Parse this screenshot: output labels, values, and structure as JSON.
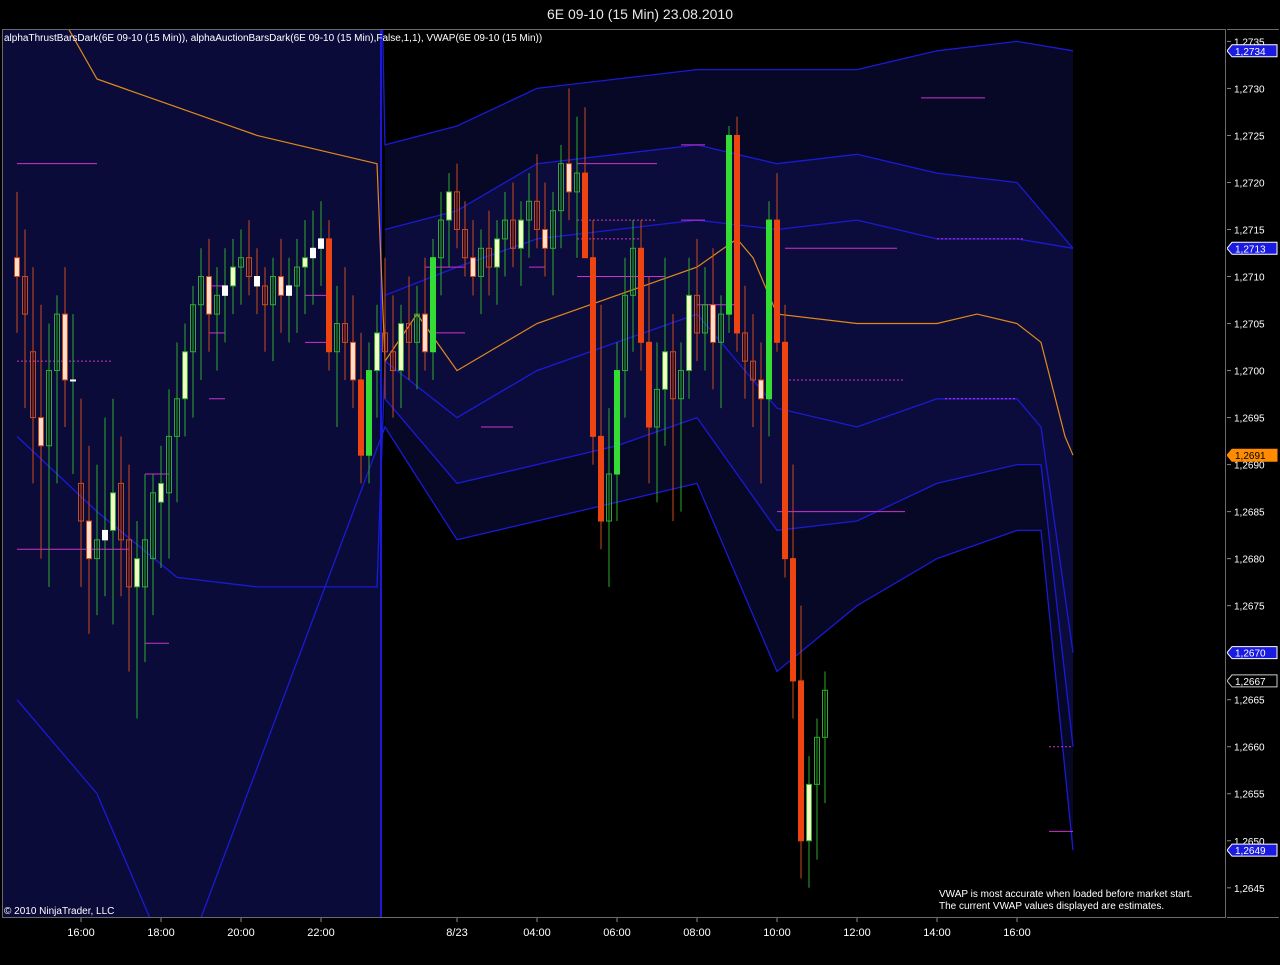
{
  "window": {
    "title": "6E 09-10 (15 Min)  23.08.2010"
  },
  "indicator_label": "alphaThrustBarsDark(6E 09-10 (15 Min)), alphaAuctionBarsDark(6E 09-10 (15 Min),False,1,1), VWAP(6E 09-10 (15 Min))",
  "copyright": "© 2010 NinjaTrader, LLC",
  "notes": {
    "vwap_line1": "VWAP is most accurate when loaded before market start.",
    "vwap_line2": "The current VWAP values displayed are estimates."
  },
  "colors": {
    "background": "#000000",
    "session_shade": "#0b0b3a",
    "band_line": "#1a1ad6",
    "vwap_line": "#e08a1c",
    "up_thrust": "#33dd33",
    "down_thrust": "#ee4411",
    "wick_green": "#2eaa2e",
    "wick_orange": "#cc4a1a",
    "level_marker": "#cc33cc",
    "badge_blue": "#1a1ae0",
    "badge_orange": "#ff8c00"
  },
  "chart_data": {
    "type": "candlestick",
    "symbol": "6E 09-10",
    "interval": "15 Min",
    "date": "23.08.2010",
    "y_axis": {
      "ticks": [
        "1,2735",
        "1,2730",
        "1,2725",
        "1,2720",
        "1,2715",
        "1,2710",
        "1,2705",
        "1,2700",
        "1,2695",
        "1,2690",
        "1,2685",
        "1,2680",
        "1,2675",
        "1,2670",
        "1,2665",
        "1,2660",
        "1,2655",
        "1,2650",
        "1,2645"
      ],
      "range": [
        1.2642,
        1.2736
      ]
    },
    "x_axis": {
      "ticks": [
        "16:00",
        "18:00",
        "20:00",
        "22:00",
        "8/23",
        "04:00",
        "06:00",
        "08:00",
        "10:00",
        "12:00",
        "14:00",
        "16:00"
      ],
      "tick_bar_index": [
        8,
        18,
        28,
        38,
        55,
        65,
        75,
        85,
        95,
        105,
        115,
        125
      ]
    },
    "session_break_bar": 45.5,
    "price_badges": [
      {
        "label": "1,2734",
        "value": 1.2734,
        "style": "blue"
      },
      {
        "label": "1,2713",
        "value": 1.2713,
        "style": "blue"
      },
      {
        "label": "1,2691",
        "value": 1.2691,
        "style": "orange"
      },
      {
        "label": "1,2670",
        "value": 1.267,
        "style": "blue"
      },
      {
        "label": "1,2667",
        "value": 1.2667,
        "style": "black"
      },
      {
        "label": "1,2649",
        "value": 1.2649,
        "style": "blue"
      }
    ],
    "bars_ohlc": [
      [
        1.2712,
        1.2719,
        1.2704,
        1.271
      ],
      [
        1.271,
        1.2715,
        1.2696,
        1.2706
      ],
      [
        1.2702,
        1.2711,
        1.2688,
        1.2695
      ],
      [
        1.2695,
        1.2707,
        1.268,
        1.2692
      ],
      [
        1.2692,
        1.2705,
        1.2677,
        1.27
      ],
      [
        1.27,
        1.2708,
        1.2688,
        1.2706
      ],
      [
        1.2706,
        1.2711,
        1.2694,
        1.2699
      ],
      [
        1.2699,
        1.2706,
        1.2689,
        1.2699
      ],
      [
        1.2688,
        1.2697,
        1.2677,
        1.2684
      ],
      [
        1.2684,
        1.2692,
        1.2672,
        1.268
      ],
      [
        1.268,
        1.269,
        1.2674,
        1.2682
      ],
      [
        1.2682,
        1.2695,
        1.2676,
        1.2683
      ],
      [
        1.2683,
        1.2697,
        1.2673,
        1.2687
      ],
      [
        1.2688,
        1.2693,
        1.2676,
        1.2682
      ],
      [
        1.2682,
        1.269,
        1.2668,
        1.2677
      ],
      [
        1.2677,
        1.2684,
        1.2663,
        1.268
      ],
      [
        1.2677,
        1.2689,
        1.2669,
        1.2682
      ],
      [
        1.268,
        1.2689,
        1.2674,
        1.2687
      ],
      [
        1.2686,
        1.2692,
        1.2679,
        1.2688
      ],
      [
        1.2687,
        1.2698,
        1.268,
        1.2693
      ],
      [
        1.2693,
        1.2703,
        1.2686,
        1.2697
      ],
      [
        1.2697,
        1.2705,
        1.2693,
        1.2702
      ],
      [
        1.2702,
        1.2709,
        1.2695,
        1.2707
      ],
      [
        1.2707,
        1.2713,
        1.2699,
        1.271
      ],
      [
        1.271,
        1.2714,
        1.2702,
        1.2706
      ],
      [
        1.2706,
        1.2711,
        1.27,
        1.2708
      ],
      [
        1.2708,
        1.2713,
        1.2703,
        1.2709
      ],
      [
        1.2709,
        1.2714,
        1.2706,
        1.2711
      ],
      [
        1.2711,
        1.2715,
        1.2707,
        1.2712
      ],
      [
        1.2712,
        1.2716,
        1.2708,
        1.271
      ],
      [
        1.271,
        1.2713,
        1.2706,
        1.2709
      ],
      [
        1.2709,
        1.2711,
        1.2702,
        1.2707
      ],
      [
        1.2707,
        1.2712,
        1.2701,
        1.271
      ],
      [
        1.271,
        1.2714,
        1.2704,
        1.2708
      ],
      [
        1.2708,
        1.2712,
        1.2703,
        1.2709
      ],
      [
        1.2709,
        1.2714,
        1.2704,
        1.2711
      ],
      [
        1.2711,
        1.2716,
        1.2706,
        1.2712
      ],
      [
        1.2712,
        1.2717,
        1.2707,
        1.2713
      ],
      [
        1.2713,
        1.2718,
        1.2709,
        1.2714
      ],
      [
        1.2714,
        1.2716,
        1.27,
        1.2702
      ],
      [
        1.2702,
        1.2709,
        1.2694,
        1.2705
      ],
      [
        1.2705,
        1.2711,
        1.2699,
        1.2703
      ],
      [
        1.2703,
        1.2708,
        1.2696,
        1.2699
      ],
      [
        1.2699,
        1.2704,
        1.2688,
        1.2691
      ],
      [
        1.2691,
        1.2703,
        1.2688,
        1.27
      ],
      [
        1.27,
        1.2707,
        1.2695,
        1.2704
      ],
      [
        1.2704,
        1.2712,
        1.2697,
        1.2702
      ],
      [
        1.2702,
        1.2708,
        1.2695,
        1.27
      ],
      [
        1.27,
        1.2707,
        1.2696,
        1.2705
      ],
      [
        1.2705,
        1.271,
        1.2699,
        1.2703
      ],
      [
        1.2703,
        1.2709,
        1.2698,
        1.2706
      ],
      [
        1.2706,
        1.2712,
        1.27,
        1.2702
      ],
      [
        1.2702,
        1.2714,
        1.2699,
        1.2712
      ],
      [
        1.2712,
        1.2719,
        1.2708,
        1.2716
      ],
      [
        1.2716,
        1.2721,
        1.2711,
        1.2719
      ],
      [
        1.2719,
        1.2722,
        1.2713,
        1.2715
      ],
      [
        1.2715,
        1.2718,
        1.271,
        1.2712
      ],
      [
        1.2712,
        1.2716,
        1.2708,
        1.271
      ],
      [
        1.271,
        1.2715,
        1.2706,
        1.2713
      ],
      [
        1.2713,
        1.2717,
        1.2708,
        1.2711
      ],
      [
        1.2711,
        1.2716,
        1.2707,
        1.2714
      ],
      [
        1.2714,
        1.2719,
        1.271,
        1.2716
      ],
      [
        1.2716,
        1.272,
        1.2711,
        1.2713
      ],
      [
        1.2713,
        1.2718,
        1.2709,
        1.2716
      ],
      [
        1.2716,
        1.2721,
        1.2712,
        1.2718
      ],
      [
        1.2718,
        1.2723,
        1.2713,
        1.2715
      ],
      [
        1.2715,
        1.272,
        1.271,
        1.2713
      ],
      [
        1.2713,
        1.2719,
        1.2708,
        1.2717
      ],
      [
        1.2717,
        1.2724,
        1.2713,
        1.2722
      ],
      [
        1.2722,
        1.273,
        1.2716,
        1.2719
      ],
      [
        1.2719,
        1.2727,
        1.2712,
        1.2721
      ],
      [
        1.2721,
        1.2728,
        1.2714,
        1.2712
      ],
      [
        1.2712,
        1.2716,
        1.269,
        1.2693
      ],
      [
        1.2693,
        1.2707,
        1.2681,
        1.2684
      ],
      [
        1.2684,
        1.2696,
        1.2677,
        1.2689
      ],
      [
        1.2689,
        1.2703,
        1.2684,
        1.27
      ],
      [
        1.27,
        1.2712,
        1.2695,
        1.2708
      ],
      [
        1.2708,
        1.2716,
        1.2702,
        1.2713
      ],
      [
        1.2713,
        1.2716,
        1.27,
        1.2703
      ],
      [
        1.2703,
        1.271,
        1.2688,
        1.2694
      ],
      [
        1.2694,
        1.2703,
        1.2686,
        1.2698
      ],
      [
        1.2698,
        1.2712,
        1.2692,
        1.2702
      ],
      [
        1.2702,
        1.2706,
        1.2684,
        1.2697
      ],
      [
        1.2697,
        1.2703,
        1.2685,
        1.27
      ],
      [
        1.27,
        1.2712,
        1.2697,
        1.2708
      ],
      [
        1.2708,
        1.2714,
        1.2701,
        1.2704
      ],
      [
        1.2704,
        1.2711,
        1.27,
        1.2707
      ],
      [
        1.2707,
        1.2713,
        1.2698,
        1.2703
      ],
      [
        1.2703,
        1.2708,
        1.2696,
        1.2706
      ],
      [
        1.2706,
        1.2726,
        1.2704,
        1.2725
      ],
      [
        1.2725,
        1.2727,
        1.2702,
        1.2704
      ],
      [
        1.2704,
        1.2709,
        1.2697,
        1.2701
      ],
      [
        1.2701,
        1.2706,
        1.2694,
        1.2699
      ],
      [
        1.2699,
        1.2703,
        1.2688,
        1.2697
      ],
      [
        1.2697,
        1.2718,
        1.2693,
        1.2716
      ],
      [
        1.2716,
        1.2721,
        1.2702,
        1.2703
      ],
      [
        1.2703,
        1.2707,
        1.2678,
        1.268
      ],
      [
        1.268,
        1.269,
        1.2663,
        1.2667
      ],
      [
        1.2667,
        1.2675,
        1.2646,
        1.265
      ],
      [
        1.265,
        1.2659,
        1.2645,
        1.2656
      ],
      [
        1.2656,
        1.2663,
        1.2648,
        1.2661
      ],
      [
        1.2661,
        1.2668,
        1.2654,
        1.2666
      ]
    ],
    "vwap_points": [
      [
        0,
        1.2746
      ],
      [
        10,
        1.2731
      ],
      [
        20,
        1.2728
      ],
      [
        30,
        1.2725
      ],
      [
        40,
        1.2723
      ],
      [
        45,
        1.2722
      ],
      [
        46,
        1.2701
      ],
      [
        50,
        1.2706
      ],
      [
        55,
        1.27
      ],
      [
        65,
        1.2705
      ],
      [
        75,
        1.2708
      ],
      [
        85,
        1.2711
      ],
      [
        90,
        1.2714
      ],
      [
        92,
        1.2712
      ],
      [
        95,
        1.2706
      ],
      [
        105,
        1.2705
      ],
      [
        115,
        1.2705
      ],
      [
        120,
        1.2706
      ],
      [
        125,
        1.2705
      ],
      [
        128,
        1.2703
      ],
      [
        131,
        1.2693
      ],
      [
        132,
        1.2691
      ]
    ],
    "bands_upper": [
      [
        [
          0,
          1.278
        ],
        [
          40,
          1.277
        ],
        [
          45,
          1.2765
        ],
        [
          46,
          1.2724
        ],
        [
          55,
          1.2726
        ],
        [
          65,
          1.273
        ],
        [
          75,
          1.2731
        ],
        [
          85,
          1.2732
        ],
        [
          95,
          1.2732
        ],
        [
          105,
          1.2732
        ],
        [
          115,
          1.2734
        ],
        [
          125,
          1.2735
        ],
        [
          132,
          1.2734
        ]
      ],
      [
        [
          46,
          1.2715
        ],
        [
          55,
          1.2717
        ],
        [
          65,
          1.2722
        ],
        [
          75,
          1.2723
        ],
        [
          85,
          1.2724
        ],
        [
          95,
          1.2722
        ],
        [
          105,
          1.2723
        ],
        [
          115,
          1.2721
        ],
        [
          125,
          1.272
        ],
        [
          132,
          1.2713
        ]
      ],
      [
        [
          46,
          1.2708
        ],
        [
          55,
          1.2711
        ],
        [
          65,
          1.2714
        ],
        [
          75,
          1.2715
        ],
        [
          85,
          1.2716
        ],
        [
          95,
          1.2715
        ],
        [
          105,
          1.2716
        ],
        [
          115,
          1.2714
        ],
        [
          125,
          1.2714
        ],
        [
          132,
          1.2713
        ]
      ]
    ],
    "bands_lower": [
      [
        [
          0,
          1.2693
        ],
        [
          10,
          1.2685
        ],
        [
          20,
          1.2678
        ],
        [
          30,
          1.2677
        ],
        [
          40,
          1.2677
        ],
        [
          45,
          1.2677
        ],
        [
          46,
          1.2701
        ],
        [
          55,
          1.2695
        ],
        [
          65,
          1.27
        ],
        [
          75,
          1.2703
        ],
        [
          85,
          1.2706
        ],
        [
          95,
          1.2696
        ],
        [
          105,
          1.2694
        ],
        [
          115,
          1.2697
        ],
        [
          125,
          1.2697
        ],
        [
          128,
          1.2694
        ],
        [
          132,
          1.267
        ]
      ],
      [
        [
          46,
          1.2697
        ],
        [
          55,
          1.2688
        ],
        [
          65,
          1.269
        ],
        [
          75,
          1.2692
        ],
        [
          85,
          1.2695
        ],
        [
          95,
          1.2683
        ],
        [
          105,
          1.2684
        ],
        [
          115,
          1.2688
        ],
        [
          125,
          1.269
        ],
        [
          128,
          1.269
        ],
        [
          132,
          1.266
        ]
      ],
      [
        [
          0,
          1.2665
        ],
        [
          10,
          1.2655
        ],
        [
          20,
          1.2635
        ],
        [
          46,
          1.2694
        ],
        [
          55,
          1.2682
        ],
        [
          65,
          1.2684
        ],
        [
          75,
          1.2686
        ],
        [
          85,
          1.2688
        ],
        [
          95,
          1.2668
        ],
        [
          105,
          1.2675
        ],
        [
          115,
          1.268
        ],
        [
          125,
          1.2683
        ],
        [
          128,
          1.2683
        ],
        [
          132,
          1.2649
        ]
      ]
    ],
    "level_markers": [
      [
        0,
        10,
        1.2722,
        "solid"
      ],
      [
        0,
        12,
        1.2701,
        "dashed"
      ],
      [
        0,
        14,
        1.2681,
        "solid"
      ],
      [
        16,
        19,
        1.2689,
        "solid"
      ],
      [
        16,
        19,
        1.2671,
        "solid"
      ],
      [
        24,
        26,
        1.2709,
        "solid"
      ],
      [
        24,
        26,
        1.2704,
        "solid"
      ],
      [
        24,
        26,
        1.2697,
        "solid"
      ],
      [
        36,
        39,
        1.2708,
        "solid"
      ],
      [
        36,
        39,
        1.2703,
        "solid"
      ],
      [
        51,
        56,
        1.2711,
        "solid"
      ],
      [
        52,
        56,
        1.2704,
        "solid"
      ],
      [
        58,
        62,
        1.2694,
        "solid"
      ],
      [
        64,
        66,
        1.2711,
        "solid"
      ],
      [
        70,
        80,
        1.2722,
        "solid"
      ],
      [
        70,
        80,
        1.2716,
        "dashed"
      ],
      [
        70,
        78,
        1.2714,
        "dashed"
      ],
      [
        70,
        81,
        1.271,
        "solid"
      ],
      [
        83,
        86,
        1.2724,
        "solid"
      ],
      [
        83,
        86,
        1.2716,
        "solid"
      ],
      [
        85,
        90,
        1.2707,
        "solid"
      ],
      [
        96,
        110,
        1.2713,
        "solid"
      ],
      [
        96,
        111,
        1.2699,
        "dashed"
      ],
      [
        95,
        111,
        1.2685,
        "solid"
      ],
      [
        113,
        121,
        1.2729,
        "solid"
      ],
      [
        115,
        126,
        1.2714,
        "dashed"
      ],
      [
        116,
        125,
        1.2697,
        "dashed"
      ],
      [
        129,
        132,
        1.266,
        "dashed"
      ],
      [
        129,
        132,
        1.2651,
        "solid"
      ]
    ]
  }
}
